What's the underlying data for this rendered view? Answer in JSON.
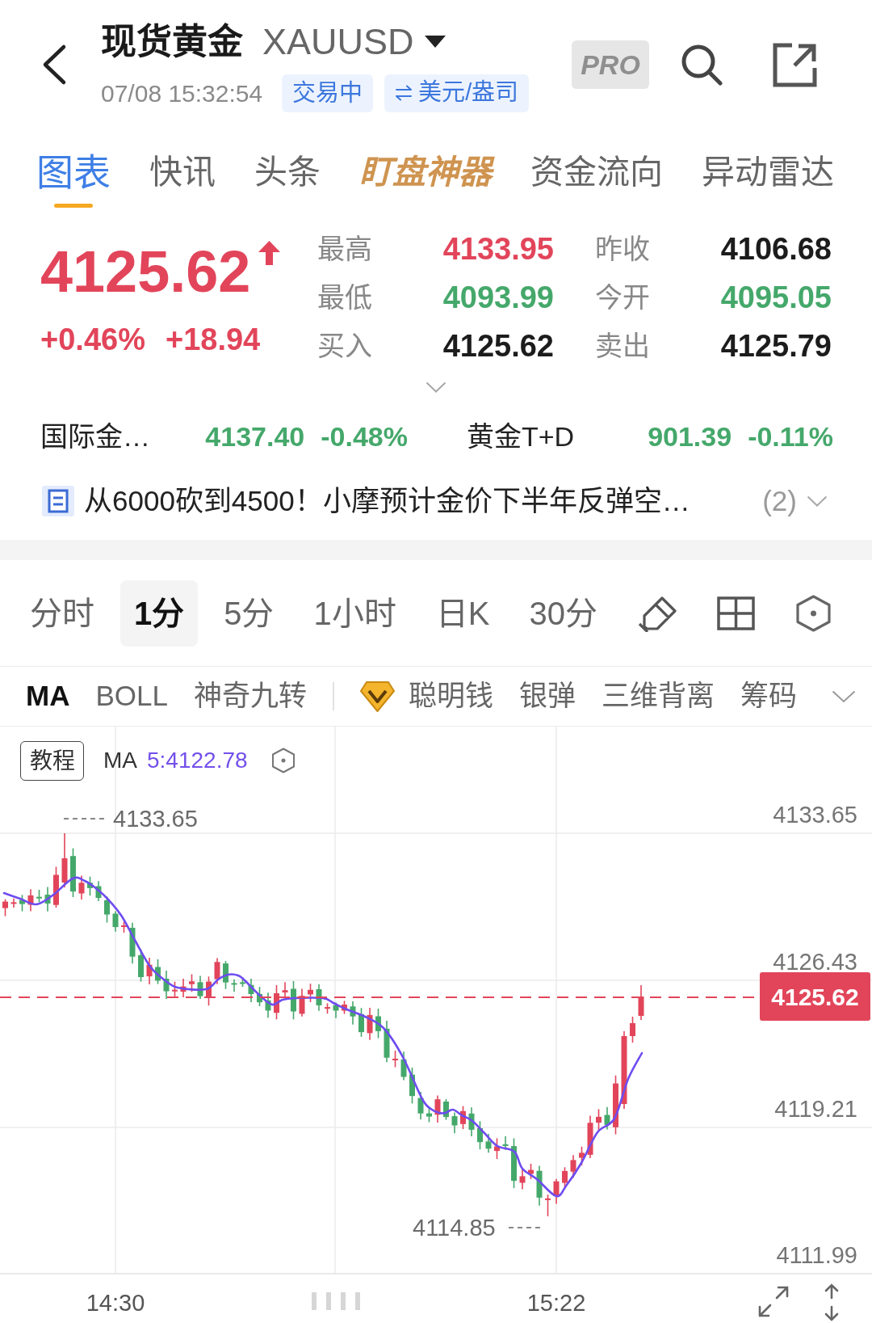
{
  "header": {
    "title": "现货黄金",
    "symbol": "XAUUSD",
    "timestamp": "07/08 15:32:54",
    "status_tag": "交易中",
    "unit_tag": "美元/盎司",
    "pro_badge": "PRO"
  },
  "tabs": [
    {
      "label": "图表",
      "kind": "plain",
      "selected": true
    },
    {
      "label": "快讯",
      "kind": "plain",
      "selected": false
    },
    {
      "label": "头条",
      "kind": "plain",
      "selected": false
    },
    {
      "label": "盯盘神器",
      "kind": "featured",
      "selected": false
    },
    {
      "label": "资金流向",
      "kind": "plain",
      "selected": false
    },
    {
      "label": "异动雷达",
      "kind": "plain",
      "selected": false
    }
  ],
  "quote": {
    "price": "4125.62",
    "rising": true,
    "change_percent": "+0.46%",
    "change": "+18.94",
    "stats": [
      {
        "label": "最高",
        "value": "4133.95",
        "color": "#e2455a"
      },
      {
        "label": "昨收",
        "value": "4106.68",
        "color": "#1c1c1c"
      },
      {
        "label": "最低",
        "value": "4093.99",
        "color": "#45a86b"
      },
      {
        "label": "今开",
        "value": "4095.05",
        "color": "#45a86b"
      },
      {
        "label": "买入",
        "value": "4125.62",
        "color": "#1c1c1c"
      },
      {
        "label": "卖出",
        "value": "4125.79",
        "color": "#1c1c1c"
      }
    ]
  },
  "related": [
    {
      "name": "国际金…",
      "price": "4137.40",
      "change": "-0.48%",
      "color": "#45a86b"
    },
    {
      "name": "黄金T+D",
      "price": "901.39",
      "change": "-0.11%",
      "color": "#45a86b"
    }
  ],
  "news": {
    "headline": "从6000砍到4500！小摩预计金价下半年反弹空…",
    "count": "(2)"
  },
  "periods": [
    {
      "label": "分时",
      "selected": false
    },
    {
      "label": "1分",
      "selected": true
    },
    {
      "label": "5分",
      "selected": false
    },
    {
      "label": "1小时",
      "selected": false
    },
    {
      "label": "日K",
      "selected": false
    },
    {
      "label": "30分",
      "selected": false
    }
  ],
  "indicators": {
    "main": [
      {
        "label": "MA",
        "selected": true
      },
      {
        "label": "BOLL",
        "selected": false
      },
      {
        "label": "神奇九转",
        "selected": false
      }
    ],
    "sub": [
      {
        "label": "聪明钱",
        "kind": "premium",
        "selected": false
      },
      {
        "label": "银弹",
        "kind": "plain",
        "selected": false
      },
      {
        "label": "三维背离",
        "kind": "plain",
        "selected": false
      },
      {
        "label": "筹码",
        "kind": "plain",
        "selected": false
      }
    ]
  },
  "chart": {
    "tutorial_button": "教程",
    "ma_label": "MA",
    "ma_value": "5:4122.78",
    "high_marker": "4133.65",
    "low_marker": "4114.85",
    "y_axis_labels": [
      "4133.65",
      "4126.43",
      "4119.21",
      "4111.99"
    ],
    "last_price_tag": "4125.62",
    "x_axis_labels": [
      "14:30",
      "15:22"
    ]
  }
}
